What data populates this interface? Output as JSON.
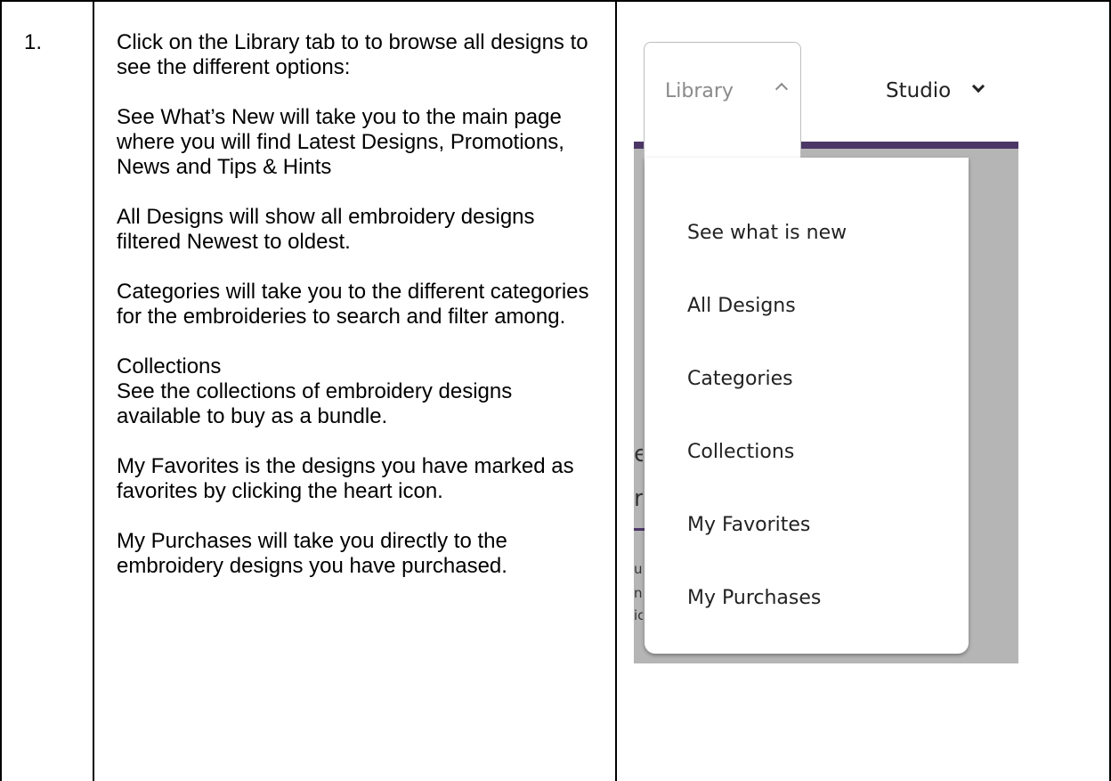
{
  "row": {
    "step_number": "1.",
    "instructions": [
      "Click on the Library tab to to browse all designs to see the different options:",
      "See What’s New will take you to the main page where you will find Latest Designs, Promotions, News and Tips & Hints",
      "All Designs will show all embroidery designs filtered Newest to oldest.",
      "Categories will take you to the different categories for the embroideries to search and filter among.",
      "Collections",
      "See the collections of embroidery designs available to buy as a bundle.",
      "My Favorites is the designs you have marked as favorites by clicking the heart icon.",
      "My Purchases will take you directly to the embroidery designs you have purchased."
    ]
  },
  "screenshot": {
    "tabs": [
      {
        "label": "Library",
        "icon": "chevron-up-icon",
        "active": true
      },
      {
        "label": "Studio",
        "icon": "chevron-down-icon",
        "active": false
      }
    ],
    "menu_items": [
      "See what is new",
      "All Designs",
      "Categories",
      "Collections",
      "My Favorites",
      "My Purchases"
    ],
    "peek_text": [
      "e",
      "r",
      "u",
      "n",
      "ic"
    ],
    "colors": {
      "accent_bar": "#4b3666",
      "backdrop": "#b5b5b5",
      "menu_bg": "#ffffff"
    }
  }
}
